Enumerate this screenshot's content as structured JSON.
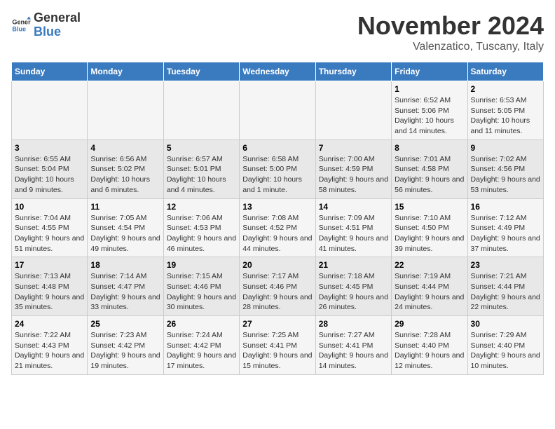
{
  "logo": {
    "line1": "General",
    "line2": "Blue"
  },
  "title": "November 2024",
  "subtitle": "Valenzatico, Tuscany, Italy",
  "days_of_week": [
    "Sunday",
    "Monday",
    "Tuesday",
    "Wednesday",
    "Thursday",
    "Friday",
    "Saturday"
  ],
  "weeks": [
    [
      {
        "day": "",
        "info": ""
      },
      {
        "day": "",
        "info": ""
      },
      {
        "day": "",
        "info": ""
      },
      {
        "day": "",
        "info": ""
      },
      {
        "day": "",
        "info": ""
      },
      {
        "day": "1",
        "info": "Sunrise: 6:52 AM\nSunset: 5:06 PM\nDaylight: 10 hours and 14 minutes."
      },
      {
        "day": "2",
        "info": "Sunrise: 6:53 AM\nSunset: 5:05 PM\nDaylight: 10 hours and 11 minutes."
      }
    ],
    [
      {
        "day": "3",
        "info": "Sunrise: 6:55 AM\nSunset: 5:04 PM\nDaylight: 10 hours and 9 minutes."
      },
      {
        "day": "4",
        "info": "Sunrise: 6:56 AM\nSunset: 5:02 PM\nDaylight: 10 hours and 6 minutes."
      },
      {
        "day": "5",
        "info": "Sunrise: 6:57 AM\nSunset: 5:01 PM\nDaylight: 10 hours and 4 minutes."
      },
      {
        "day": "6",
        "info": "Sunrise: 6:58 AM\nSunset: 5:00 PM\nDaylight: 10 hours and 1 minute."
      },
      {
        "day": "7",
        "info": "Sunrise: 7:00 AM\nSunset: 4:59 PM\nDaylight: 9 hours and 58 minutes."
      },
      {
        "day": "8",
        "info": "Sunrise: 7:01 AM\nSunset: 4:58 PM\nDaylight: 9 hours and 56 minutes."
      },
      {
        "day": "9",
        "info": "Sunrise: 7:02 AM\nSunset: 4:56 PM\nDaylight: 9 hours and 53 minutes."
      }
    ],
    [
      {
        "day": "10",
        "info": "Sunrise: 7:04 AM\nSunset: 4:55 PM\nDaylight: 9 hours and 51 minutes."
      },
      {
        "day": "11",
        "info": "Sunrise: 7:05 AM\nSunset: 4:54 PM\nDaylight: 9 hours and 49 minutes."
      },
      {
        "day": "12",
        "info": "Sunrise: 7:06 AM\nSunset: 4:53 PM\nDaylight: 9 hours and 46 minutes."
      },
      {
        "day": "13",
        "info": "Sunrise: 7:08 AM\nSunset: 4:52 PM\nDaylight: 9 hours and 44 minutes."
      },
      {
        "day": "14",
        "info": "Sunrise: 7:09 AM\nSunset: 4:51 PM\nDaylight: 9 hours and 41 minutes."
      },
      {
        "day": "15",
        "info": "Sunrise: 7:10 AM\nSunset: 4:50 PM\nDaylight: 9 hours and 39 minutes."
      },
      {
        "day": "16",
        "info": "Sunrise: 7:12 AM\nSunset: 4:49 PM\nDaylight: 9 hours and 37 minutes."
      }
    ],
    [
      {
        "day": "17",
        "info": "Sunrise: 7:13 AM\nSunset: 4:48 PM\nDaylight: 9 hours and 35 minutes."
      },
      {
        "day": "18",
        "info": "Sunrise: 7:14 AM\nSunset: 4:47 PM\nDaylight: 9 hours and 33 minutes."
      },
      {
        "day": "19",
        "info": "Sunrise: 7:15 AM\nSunset: 4:46 PM\nDaylight: 9 hours and 30 minutes."
      },
      {
        "day": "20",
        "info": "Sunrise: 7:17 AM\nSunset: 4:46 PM\nDaylight: 9 hours and 28 minutes."
      },
      {
        "day": "21",
        "info": "Sunrise: 7:18 AM\nSunset: 4:45 PM\nDaylight: 9 hours and 26 minutes."
      },
      {
        "day": "22",
        "info": "Sunrise: 7:19 AM\nSunset: 4:44 PM\nDaylight: 9 hours and 24 minutes."
      },
      {
        "day": "23",
        "info": "Sunrise: 7:21 AM\nSunset: 4:44 PM\nDaylight: 9 hours and 22 minutes."
      }
    ],
    [
      {
        "day": "24",
        "info": "Sunrise: 7:22 AM\nSunset: 4:43 PM\nDaylight: 9 hours and 21 minutes."
      },
      {
        "day": "25",
        "info": "Sunrise: 7:23 AM\nSunset: 4:42 PM\nDaylight: 9 hours and 19 minutes."
      },
      {
        "day": "26",
        "info": "Sunrise: 7:24 AM\nSunset: 4:42 PM\nDaylight: 9 hours and 17 minutes."
      },
      {
        "day": "27",
        "info": "Sunrise: 7:25 AM\nSunset: 4:41 PM\nDaylight: 9 hours and 15 minutes."
      },
      {
        "day": "28",
        "info": "Sunrise: 7:27 AM\nSunset: 4:41 PM\nDaylight: 9 hours and 14 minutes."
      },
      {
        "day": "29",
        "info": "Sunrise: 7:28 AM\nSunset: 4:40 PM\nDaylight: 9 hours and 12 minutes."
      },
      {
        "day": "30",
        "info": "Sunrise: 7:29 AM\nSunset: 4:40 PM\nDaylight: 9 hours and 10 minutes."
      }
    ]
  ]
}
